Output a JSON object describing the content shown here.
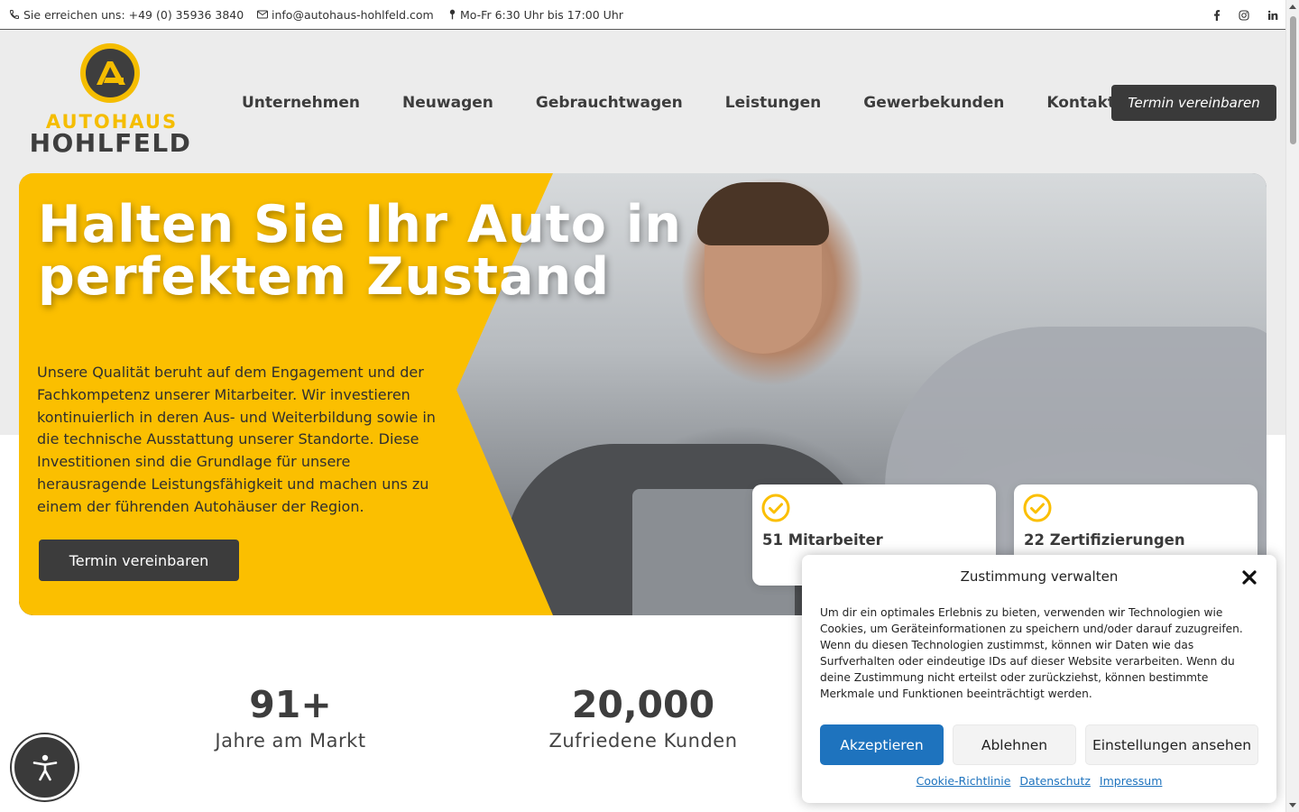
{
  "topbar": {
    "phone": "Sie erreichen uns: +49 (0) 35936 3840",
    "email": "info@autohaus-hohlfeld.com",
    "hours": "Mo-Fr 6:30 Uhr bis 17:00 Uhr",
    "social": [
      {
        "icon": "facebook-icon"
      },
      {
        "icon": "instagram-icon"
      },
      {
        "icon": "linkedin-icon"
      }
    ]
  },
  "logo": {
    "line1": "AUTOHAUS",
    "line2": "HOHLFELD"
  },
  "nav": {
    "items": [
      "Unternehmen",
      "Neuwagen",
      "Gebrauchtwagen",
      "Leistungen",
      "Gewerbekunden",
      "Kontakt"
    ],
    "cta": "Termin vereinbaren"
  },
  "hero": {
    "title": "Halten Sie Ihr Auto in perfektem Zustand",
    "text": "Unsere Qualität beruht auf dem Engagement und der Fachkompetenz unserer Mitarbeiter. Wir investieren kontinuierlich in deren Aus- und Weiterbildung sowie in die technische Ausstattung unserer Standorte. Diese Investitionen sind die Grundlage für unsere herausragende Leistungsfähigkeit und machen uns zu einem der führenden Autohäuser der Region.",
    "cta": "Termin vereinbaren",
    "cards": [
      "51 Mitarbeiter",
      "22 Zertifizierungen"
    ]
  },
  "stats": [
    {
      "num": "91+",
      "label": "Jahre am Markt"
    },
    {
      "num": "20,000",
      "label": "Zufriedene Kunden"
    }
  ],
  "consent": {
    "title": "Zustimmung verwalten",
    "message": "Um dir ein optimales Erlebnis zu bieten, verwenden wir Technologien wie Cookies, um Geräteinformationen zu speichern und/oder darauf zuzugreifen. Wenn du diesen Technologien zustimmst, können wir Daten wie das Surfverhalten oder eindeutige IDs auf dieser Website verarbeiten. Wenn du deine Zustimmung nicht erteilst oder zurückziehst, können bestimmte Merkmale und Funktionen beeinträchtigt werden.",
    "accept": "Akzeptieren",
    "deny": "Ablehnen",
    "preferences": "Einstellungen ansehen",
    "links": [
      "Cookie-Richtlinie",
      "Datenschutz",
      "Impressum"
    ]
  },
  "colors": {
    "brand_yellow": "#fbbf00",
    "dark": "#3a3a3a",
    "accept_blue": "#1e73be"
  }
}
